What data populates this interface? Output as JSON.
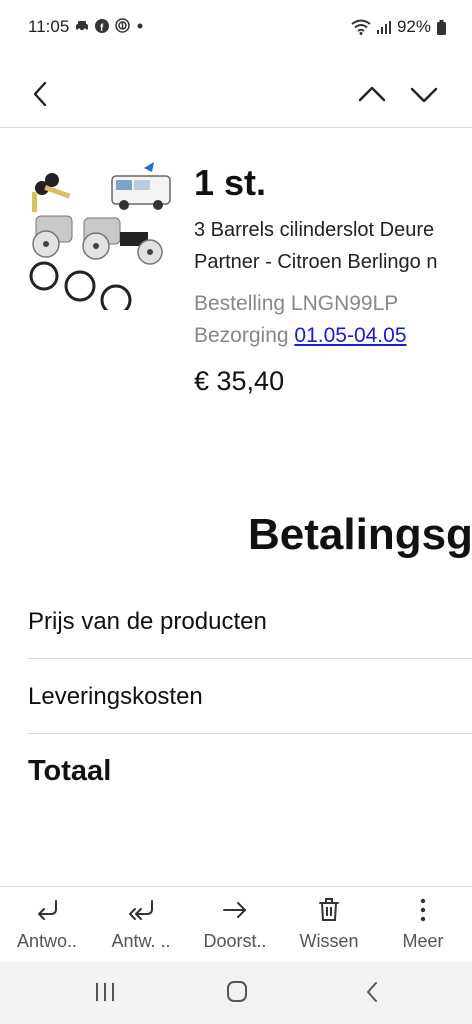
{
  "status_bar": {
    "time": "11:05",
    "battery": "92%"
  },
  "product": {
    "quantity": "1 st.",
    "title_line1": "3 Barrels cilinderslot Deure",
    "title_line2": "Partner - Citroen Berlingo n",
    "order_label": "Bestelling LNGN99LP",
    "delivery_label": "Bezorging",
    "delivery_dates": "01.05-04.05",
    "price": "€ 35,40"
  },
  "summary": {
    "heading": "Betalingsg",
    "rows": [
      {
        "label": "Prijs van de producten"
      },
      {
        "label": "Leveringskosten"
      },
      {
        "label": "Totaal"
      }
    ]
  },
  "actions": [
    {
      "label": "Antwo..",
      "icon": "reply-icon"
    },
    {
      "label": "Antw. ..",
      "icon": "reply-all-icon"
    },
    {
      "label": "Doorst..",
      "icon": "forward-icon"
    },
    {
      "label": "Wissen",
      "icon": "trash-icon"
    },
    {
      "label": "Meer",
      "icon": "more-vertical-icon"
    }
  ],
  "colors": {
    "link": "#1a1ad6",
    "muted": "#888888",
    "divider": "#d9d9d9",
    "nav_bar": "#f2f2f2"
  }
}
